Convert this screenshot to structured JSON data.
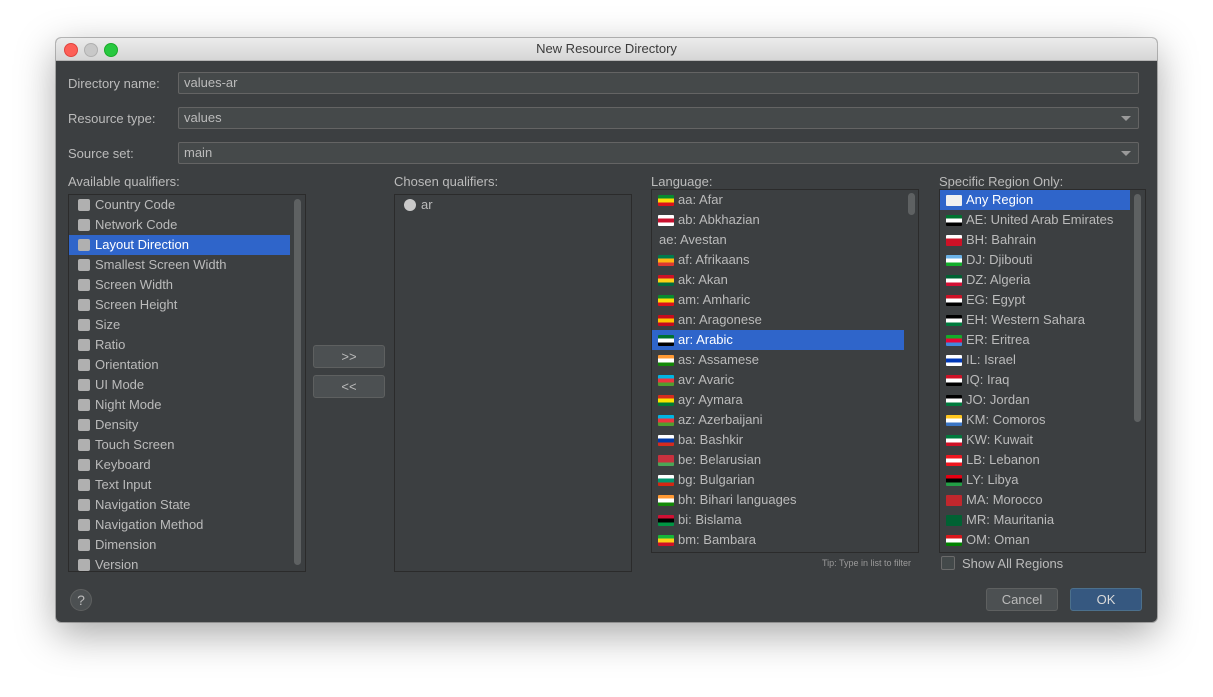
{
  "window": {
    "title": "New Resource Directory"
  },
  "form": {
    "directory_name_label": "Directory name:",
    "directory_name_value": "values-ar",
    "resource_type_label": "Resource type:",
    "resource_type_value": "values",
    "source_set_label": "Source set:",
    "source_set_value": "main"
  },
  "available": {
    "label": "Available qualifiers:",
    "items": [
      {
        "label": "Country Code",
        "icon": "country-code-icon"
      },
      {
        "label": "Network Code",
        "icon": "network-code-icon"
      },
      {
        "label": "Layout Direction",
        "icon": "layout-direction-icon",
        "selected": true
      },
      {
        "label": "Smallest Screen Width",
        "icon": "smallest-width-icon"
      },
      {
        "label": "Screen Width",
        "icon": "screen-width-icon"
      },
      {
        "label": "Screen Height",
        "icon": "screen-height-icon"
      },
      {
        "label": "Size",
        "icon": "size-icon"
      },
      {
        "label": "Ratio",
        "icon": "ratio-icon"
      },
      {
        "label": "Orientation",
        "icon": "orientation-icon"
      },
      {
        "label": "UI Mode",
        "icon": "ui-mode-icon"
      },
      {
        "label": "Night Mode",
        "icon": "night-mode-icon"
      },
      {
        "label": "Density",
        "icon": "density-icon"
      },
      {
        "label": "Touch Screen",
        "icon": "touch-screen-icon"
      },
      {
        "label": "Keyboard",
        "icon": "keyboard-icon"
      },
      {
        "label": "Text Input",
        "icon": "text-input-icon"
      },
      {
        "label": "Navigation State",
        "icon": "navigation-state-icon"
      },
      {
        "label": "Navigation Method",
        "icon": "navigation-method-icon"
      },
      {
        "label": "Dimension",
        "icon": "dimension-icon"
      },
      {
        "label": "Version",
        "icon": "android-icon"
      }
    ]
  },
  "buttons": {
    "add": ">>",
    "remove": "<<",
    "cancel": "Cancel",
    "ok": "OK",
    "help": "?"
  },
  "chosen": {
    "label": "Chosen qualifiers:",
    "items": [
      {
        "label": "ar",
        "icon": "globe-icon"
      }
    ]
  },
  "language": {
    "label": "Language:",
    "tip": "Tip: Type in list to filter",
    "items": [
      {
        "label": "aa: Afar",
        "colors": [
          "#078930",
          "#fcdd09",
          "#da121a"
        ]
      },
      {
        "label": "ab: Abkhazian",
        "colors": [
          "#ffffff",
          "#c8102e",
          "#ffffff"
        ]
      },
      {
        "label": "ae: Avestan",
        "colors": []
      },
      {
        "label": "af: Afrikaans",
        "colors": [
          "#007a4d",
          "#ffb612",
          "#de3831"
        ]
      },
      {
        "label": "ak: Akan",
        "colors": [
          "#ce1126",
          "#fcd116",
          "#006b3f"
        ]
      },
      {
        "label": "am: Amharic",
        "colors": [
          "#078930",
          "#fcdd09",
          "#da121a"
        ]
      },
      {
        "label": "an: Aragonese",
        "colors": [
          "#c60b1e",
          "#ffc400",
          "#c60b1e"
        ]
      },
      {
        "label": "ar: Arabic",
        "colors": [
          "#00732f",
          "#ffffff",
          "#000000"
        ],
        "selected": true
      },
      {
        "label": "as: Assamese",
        "colors": [
          "#ff9933",
          "#ffffff",
          "#138808"
        ]
      },
      {
        "label": "av: Avaric",
        "colors": [
          "#00b5e2",
          "#ef3340",
          "#509e2f"
        ]
      },
      {
        "label": "ay: Aymara",
        "colors": [
          "#d52b1e",
          "#f9e300",
          "#007934"
        ]
      },
      {
        "label": "az: Azerbaijani",
        "colors": [
          "#00b5e2",
          "#ef3340",
          "#509e2f"
        ]
      },
      {
        "label": "ba: Bashkir",
        "colors": [
          "#ffffff",
          "#0039a6",
          "#d52b1e"
        ]
      },
      {
        "label": "be: Belarusian",
        "colors": [
          "#c8313e",
          "#c8313e",
          "#4aa657"
        ]
      },
      {
        "label": "bg: Bulgarian",
        "colors": [
          "#ffffff",
          "#00966e",
          "#d62612"
        ]
      },
      {
        "label": "bh: Bihari languages",
        "colors": [
          "#ff9933",
          "#ffffff",
          "#138808"
        ]
      },
      {
        "label": "bi: Bislama",
        "colors": [
          "#d21034",
          "#000000",
          "#009543"
        ]
      },
      {
        "label": "bm: Bambara",
        "colors": [
          "#14b53a",
          "#fcd116",
          "#ce1126"
        ]
      }
    ]
  },
  "region": {
    "label": "Specific Region Only:",
    "show_all_label": "Show All Regions",
    "items": [
      {
        "label": "Any Region",
        "colors": [
          "#f0f0f0",
          "#f0f0f0",
          "#f0f0f0"
        ],
        "selected": true
      },
      {
        "label": "AE: United Arab Emirates",
        "colors": [
          "#00732f",
          "#ffffff",
          "#000000"
        ]
      },
      {
        "label": "BH: Bahrain",
        "colors": [
          "#ffffff",
          "#ce1126",
          "#ce1126"
        ]
      },
      {
        "label": "DJ: Djibouti",
        "colors": [
          "#6ab2e7",
          "#ffffff",
          "#12ad2b"
        ]
      },
      {
        "label": "DZ: Algeria",
        "colors": [
          "#006233",
          "#ffffff",
          "#d21034"
        ]
      },
      {
        "label": "EG: Egypt",
        "colors": [
          "#ce1126",
          "#ffffff",
          "#000000"
        ]
      },
      {
        "label": "EH: Western Sahara",
        "colors": [
          "#000000",
          "#ffffff",
          "#007a3d"
        ]
      },
      {
        "label": "ER: Eritrea",
        "colors": [
          "#12ad2b",
          "#ea0437",
          "#4189dd"
        ]
      },
      {
        "label": "IL: Israel",
        "colors": [
          "#ffffff",
          "#0038b8",
          "#ffffff"
        ]
      },
      {
        "label": "IQ: Iraq",
        "colors": [
          "#ce1126",
          "#ffffff",
          "#000000"
        ]
      },
      {
        "label": "JO: Jordan",
        "colors": [
          "#000000",
          "#ffffff",
          "#007a3d"
        ]
      },
      {
        "label": "KM: Comoros",
        "colors": [
          "#ffc61e",
          "#ffffff",
          "#3a75c4"
        ]
      },
      {
        "label": "KW: Kuwait",
        "colors": [
          "#007a3d",
          "#ffffff",
          "#ce1126"
        ]
      },
      {
        "label": "LB: Lebanon",
        "colors": [
          "#ee161f",
          "#ffffff",
          "#ee161f"
        ]
      },
      {
        "label": "LY: Libya",
        "colors": [
          "#e70013",
          "#000000",
          "#239e46"
        ]
      },
      {
        "label": "MA: Morocco",
        "colors": [
          "#c1272d",
          "#c1272d",
          "#c1272d"
        ]
      },
      {
        "label": "MR: Mauritania",
        "colors": [
          "#006233",
          "#006233",
          "#006233"
        ]
      },
      {
        "label": "OM: Oman",
        "colors": [
          "#db161b",
          "#ffffff",
          "#008000"
        ]
      }
    ]
  }
}
